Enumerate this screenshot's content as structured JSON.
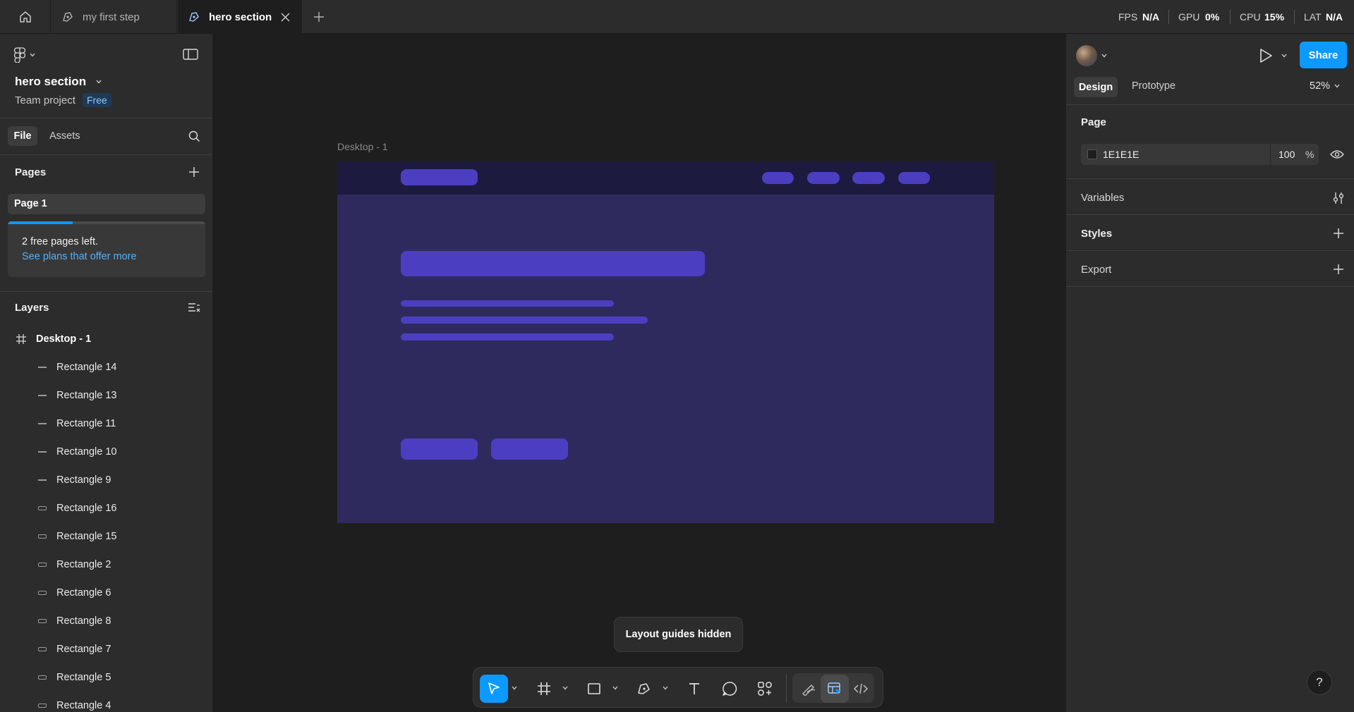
{
  "tabs": [
    {
      "label": "my first step"
    },
    {
      "label": "hero section"
    }
  ],
  "perf": {
    "fps_label": "FPS",
    "fps_value": "N/A",
    "gpu_label": "GPU",
    "gpu_value": "0%",
    "cpu_label": "CPU",
    "cpu_value": "15%",
    "lat_label": "LAT",
    "lat_value": "N/A"
  },
  "file": {
    "name": "hero section",
    "project": "Team project",
    "plan_badge": "Free"
  },
  "left_tabs": {
    "file": "File",
    "assets": "Assets"
  },
  "pages": {
    "title": "Pages",
    "items": [
      "Page 1"
    ],
    "notice_text": "2 free pages left.",
    "notice_link": "See plans that offer more",
    "progress_fraction": 0.33
  },
  "layers": {
    "title": "Layers",
    "frame": "Desktop - 1",
    "items": [
      {
        "label": "Rectangle 14",
        "kind": "line"
      },
      {
        "label": "Rectangle 13",
        "kind": "line"
      },
      {
        "label": "Rectangle 11",
        "kind": "line"
      },
      {
        "label": "Rectangle 10",
        "kind": "line"
      },
      {
        "label": "Rectangle 9",
        "kind": "line"
      },
      {
        "label": "Rectangle 16",
        "kind": "rect"
      },
      {
        "label": "Rectangle 15",
        "kind": "rect"
      },
      {
        "label": "Rectangle 2",
        "kind": "rect"
      },
      {
        "label": "Rectangle 6",
        "kind": "rect"
      },
      {
        "label": "Rectangle 8",
        "kind": "rect"
      },
      {
        "label": "Rectangle 7",
        "kind": "rect"
      },
      {
        "label": "Rectangle 5",
        "kind": "rect"
      },
      {
        "label": "Rectangle 4",
        "kind": "rect"
      }
    ]
  },
  "canvas": {
    "frame_label": "Desktop - 1",
    "toast": "Layout guides hidden",
    "frame_bg": "#2e2a5e",
    "frame_nav_bg": "#1d1a3f",
    "shape_color": "#4c3ec1"
  },
  "right": {
    "tabs": {
      "design": "Design",
      "prototype": "Prototype"
    },
    "zoom": "52%",
    "share": "Share",
    "page_title": "Page",
    "page_color": "1E1E1E",
    "page_opacity": "100",
    "page_opacity_unit": "%",
    "sections": [
      "Variables",
      "Styles",
      "Export"
    ]
  },
  "colors": {
    "accent": "#0d99ff"
  }
}
